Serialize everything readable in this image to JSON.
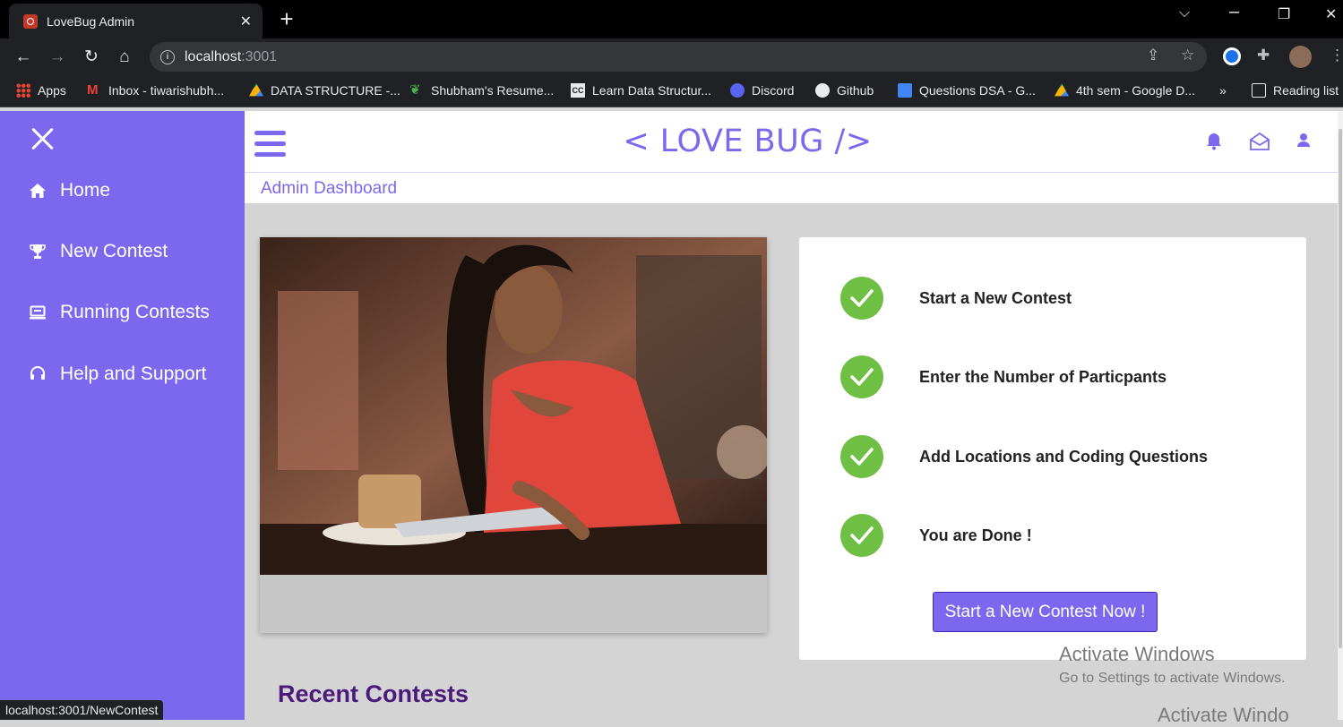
{
  "browser": {
    "tab_title": "LoveBug Admin",
    "tab_close": "✕",
    "new_tab": "+",
    "url_host": "localhost",
    "url_port": ":3001",
    "status_url": "localhost:3001/NewContest",
    "bookmarks": [
      "Apps",
      "Inbox - tiwarishubh...",
      "DATA STRUCTURE -...",
      "Shubham's Resume...",
      "Learn Data Structur...",
      "Discord",
      "Github",
      "Questions DSA - G...",
      "4th sem - Google D...",
      "»",
      "Reading list"
    ]
  },
  "app": {
    "brand": "< LOVE BUG />",
    "breadcrumb": "Admin Dashboard",
    "accent_color": "#7b68ee",
    "sidebar": {
      "items": [
        {
          "label": "Home",
          "icon": "home-icon"
        },
        {
          "label": "New Contest",
          "icon": "trophy-icon"
        },
        {
          "label": "Running Contests",
          "icon": "monitor-icon"
        },
        {
          "label": "Help and Support",
          "icon": "headset-icon"
        }
      ]
    },
    "header_icons": [
      "bell-icon",
      "mail-icon",
      "user-icon"
    ],
    "steps": [
      "Start a New Contest",
      "Enter the Number of Particpants",
      "Add Locations and Coding Questions",
      "You are Done !"
    ],
    "cta_label": "Start a New Contest Now !",
    "recent_heading": "Recent Contests"
  },
  "os": {
    "watermark_title": "Activate Windows",
    "watermark_sub": "Go to Settings to activate Windows.",
    "watermark_repeat": "Activate Windo"
  }
}
